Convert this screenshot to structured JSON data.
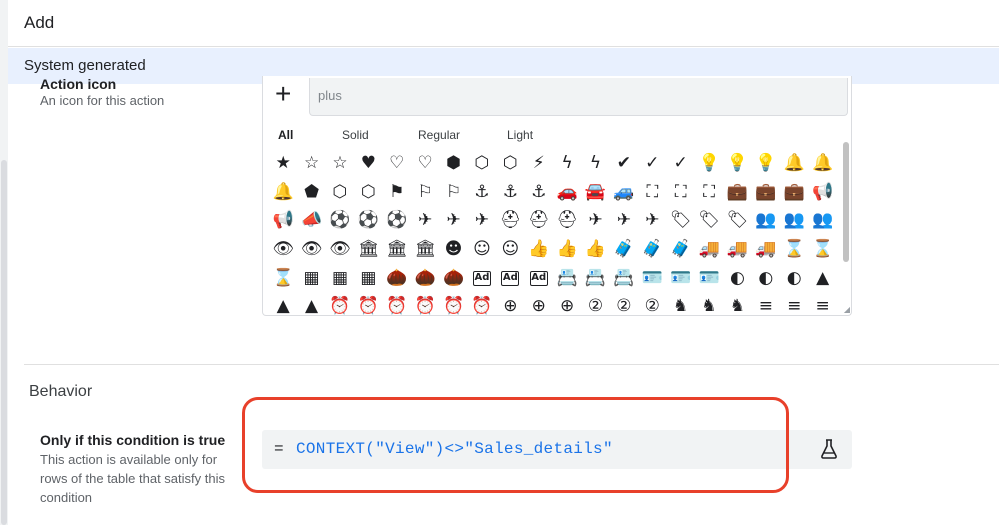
{
  "header": {
    "title": "Add"
  },
  "system_section": {
    "title": "System generated"
  },
  "action_icon": {
    "label": "Action icon",
    "description": "An icon for this action",
    "search_placeholder": "plus",
    "add_glyph": "+",
    "tabs": [
      "All",
      "Solid",
      "Regular",
      "Light"
    ],
    "icons": [
      "★",
      "☆",
      "☆",
      "♥",
      "♡",
      "♡",
      "⬢",
      "⬡",
      "⬡",
      "⚡",
      "ϟ",
      "ϟ",
      "✔",
      "✓",
      "✓",
      "💡",
      "💡",
      "💡",
      "🔔",
      "🔔",
      "🔔",
      "⬟",
      "⬡",
      "⬡",
      "⚑",
      "⚐",
      "⚐",
      "⚓",
      "⚓",
      "⚓",
      "🚗",
      "🚘",
      "🚙",
      "⛶",
      "⛶",
      "⛶",
      "💼",
      "💼",
      "💼",
      "📢",
      "📢",
      "📣",
      "⚽",
      "⚽",
      "⚽",
      "✈",
      "✈",
      "✈",
      "⛑",
      "⛑",
      "⛑",
      "✈",
      "✈",
      "✈",
      "🏷",
      "🏷",
      "🏷",
      "👥",
      "👥",
      "👥",
      "👁",
      "👁",
      "👁",
      "🏛",
      "🏛",
      "🏛",
      "☻",
      "☺",
      "☺",
      "👍",
      "👍",
      "👍",
      "🧳",
      "🧳",
      "🧳",
      "🚚",
      "🚚",
      "🚚",
      "⌛",
      "⌛",
      "⌛",
      "▦",
      "▦",
      "▦",
      "🌰",
      "🌰",
      "🌰",
      "Ad",
      "Ad",
      "Ad",
      "📇",
      "📇",
      "📇",
      "🪪",
      "🪪",
      "🪪",
      "◐",
      "◐",
      "◐",
      "▲",
      "▲",
      "▲",
      "⏰",
      "⏰",
      "⏰",
      "⏰",
      "⏰",
      "⏰",
      "⊕",
      "⊕",
      "⊕",
      "②",
      "②",
      "②",
      "♞",
      "♞",
      "♞",
      "≡",
      "≡",
      "≡"
    ]
  },
  "behavior": {
    "title": "Behavior",
    "condition_label": "Only if this condition is true",
    "condition_description": "This action is available only for rows of the table that satisfy this condition",
    "expression_prefix": "=",
    "expression": "CONTEXT(\"View\")<>\"Sales_details\"",
    "test_icon": "flask-icon"
  },
  "colors": {
    "highlight": "#e8402a",
    "expression_text": "#1a73e8",
    "system_bar": "#e8f0fe"
  }
}
